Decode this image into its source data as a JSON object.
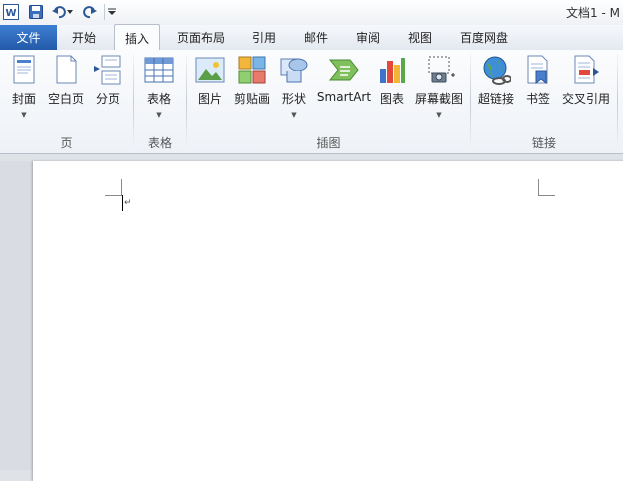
{
  "app": {
    "title": "文档1 - M"
  },
  "tabs": {
    "file": "文件",
    "items": [
      "开始",
      "插入",
      "页面布局",
      "引用",
      "邮件",
      "审阅",
      "视图",
      "百度网盘"
    ],
    "active": "插入"
  },
  "ribbon": {
    "buttons": {
      "cover": "封面",
      "blank_page": "空白页",
      "page_break": "分页",
      "table": "表格",
      "picture": "图片",
      "clipart": "剪贴画",
      "shapes": "形状",
      "smartart": "SmartArt",
      "chart": "图表",
      "screenshot": "屏幕截图",
      "hyperlink": "超链接",
      "bookmark": "书签",
      "cross_reference": "交叉引用"
    },
    "groups": {
      "pages": "页",
      "tables": "表格",
      "illustrations": "插图",
      "links": "链接"
    }
  },
  "colors": {
    "file_tab": "#2b63b5",
    "ribbon_bg": "#f4f6f9",
    "page": "#ffffff"
  }
}
